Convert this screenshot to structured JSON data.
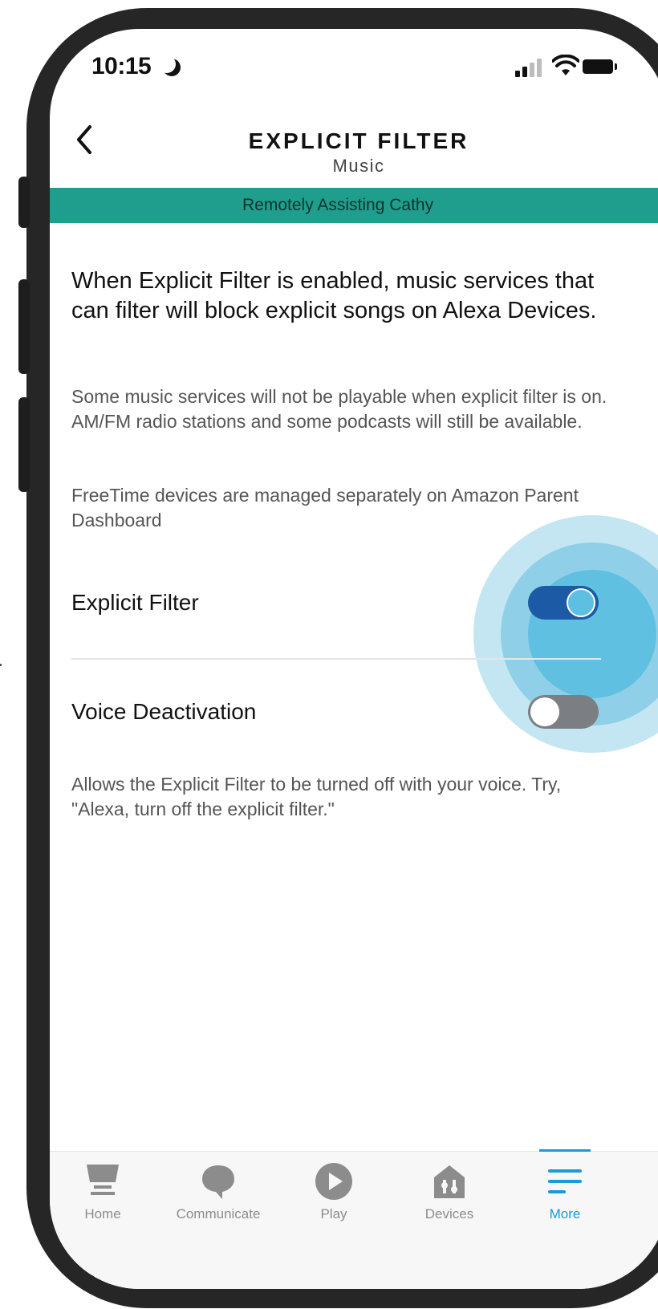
{
  "status_bar": {
    "time": "10:15"
  },
  "header": {
    "title": "EXPLICIT FILTER",
    "subtitle": "Music"
  },
  "banner": {
    "text": "Remotely Assisting Cathy",
    "color": "#1f9e8d"
  },
  "content": {
    "main_description": "When Explicit Filter is enabled, music services that can filter will block explicit songs on Alexa Devices.",
    "secondary_description": "Some music services will not be playable when explicit filter is on. AM/FM radio stations and some podcasts will still be available.",
    "freetime_note": "FreeTime devices are managed separately on Amazon Parent Dashboard"
  },
  "settings": {
    "explicit_filter": {
      "label": "Explicit Filter",
      "enabled": true
    },
    "voice_deactivation": {
      "label": "Voice Deactivation",
      "enabled": false,
      "description": "Allows the Explicit Filter to be turned off with your voice. Try, \"Alexa, turn off the explicit filter.\""
    }
  },
  "bottom_nav": {
    "items": [
      {
        "label": "Home",
        "icon": "home-icon"
      },
      {
        "label": "Communicate",
        "icon": "chat-bubble-icon"
      },
      {
        "label": "Play",
        "icon": "play-icon"
      },
      {
        "label": "Devices",
        "icon": "devices-icon"
      },
      {
        "label": "More",
        "icon": "menu-icon",
        "active": true
      }
    ]
  },
  "colors": {
    "accent_blue": "#1a9bd7",
    "toggle_on": "#1c5aa6",
    "toggle_off": "#7b7f83",
    "tap_highlight": "#5fc0e1"
  }
}
